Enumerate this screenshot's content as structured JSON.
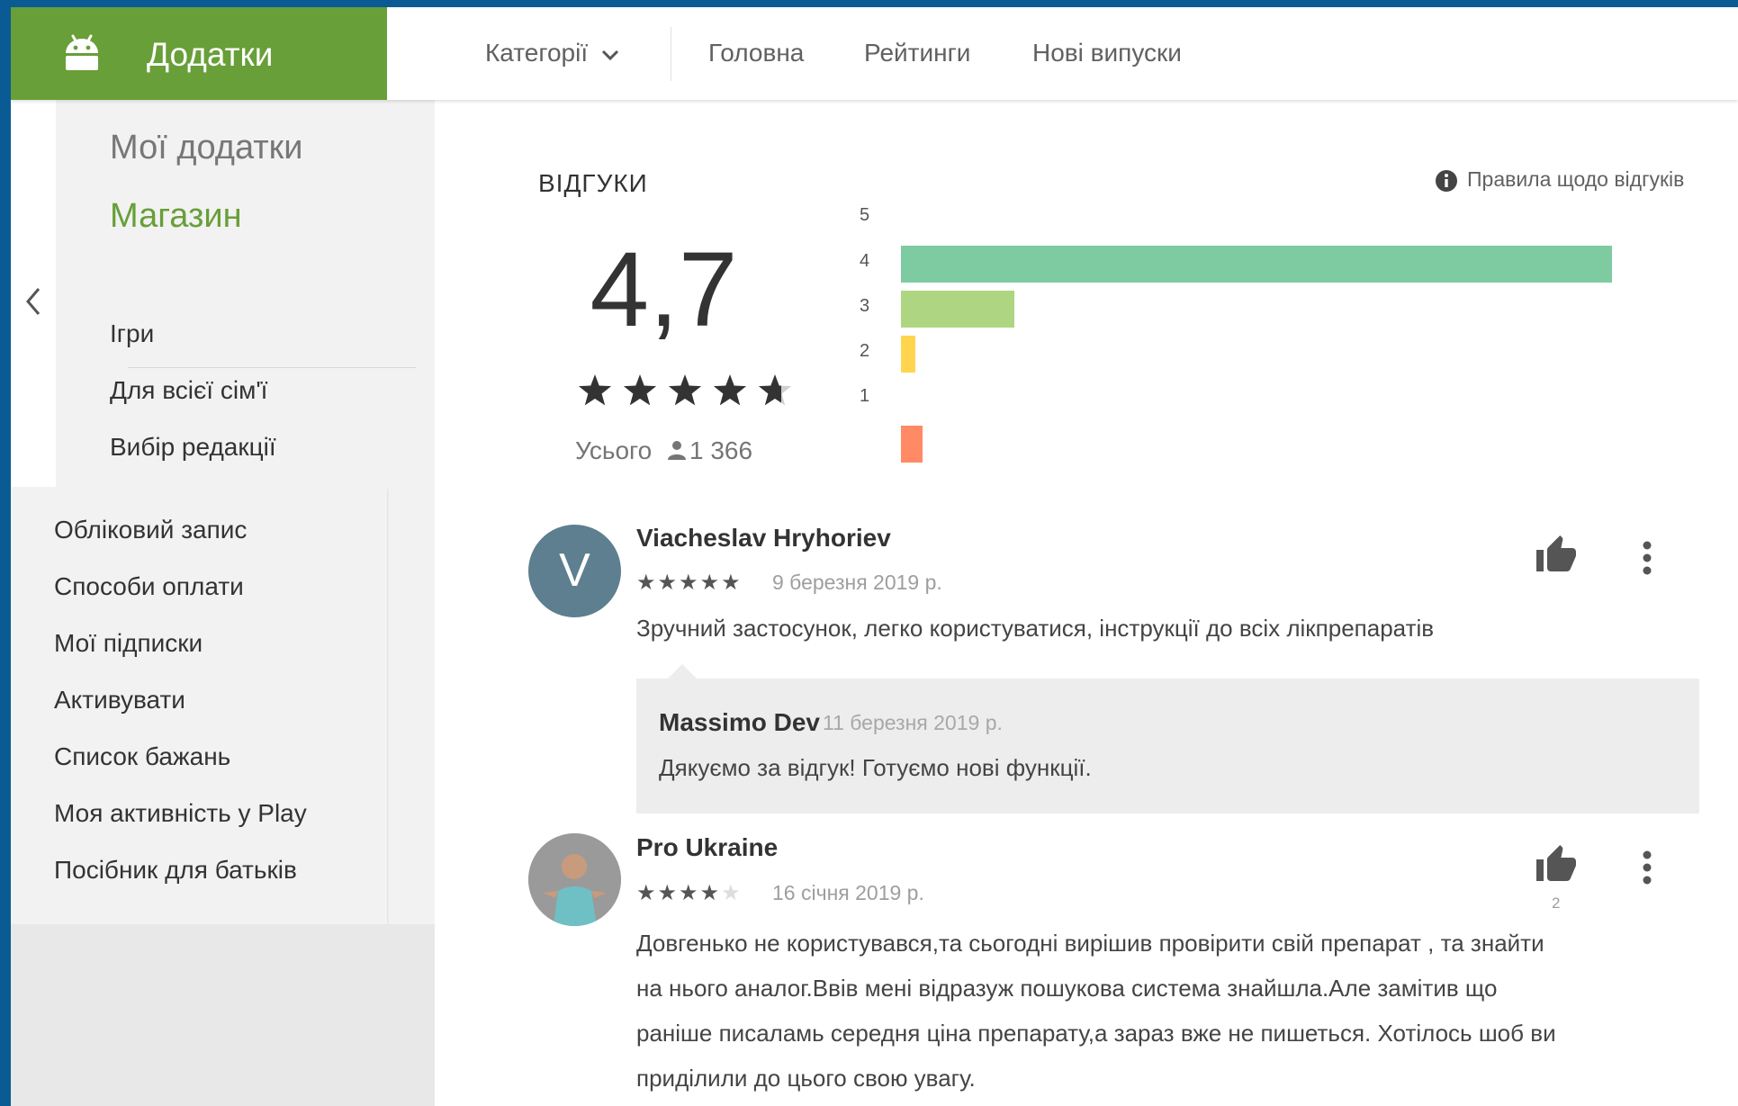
{
  "header": {
    "brand_label": "Додатки",
    "nav": {
      "categories": "Категорії",
      "home": "Головна",
      "ratings": "Рейтинги",
      "new_releases": "Нові випуски"
    }
  },
  "sidebar": {
    "my_apps": "Мої додатки",
    "store": "Магазин",
    "store_items": [
      "Ігри",
      "Для всієї сім'ї",
      "Вибір редакції"
    ],
    "account_items": [
      "Обліковий запис",
      "Способи оплати",
      "Мої підписки",
      "Активувати",
      "Список бажань",
      "Моя активність у Play",
      "Посібник для батьків"
    ]
  },
  "reviews": {
    "section_title": "ВІДГУКИ",
    "policy_link": "Правила щодо відгуків",
    "average": "4,7",
    "average_stars": 4.7,
    "total_label": "Усього",
    "total_count": "1 366",
    "histogram_labels": [
      "5",
      "4",
      "3",
      "2",
      "1"
    ],
    "histogram_fractions": [
      1.0,
      0.16,
      0.02,
      0.0,
      0.03
    ],
    "histogram_colors": [
      "#7ecba1",
      "#aed581",
      "#ffd54f",
      "#ffb74d",
      "#ff8a65"
    ],
    "items": [
      {
        "avatar_letter": "V",
        "author": "Viacheslav Hryhoriev",
        "stars": 5,
        "date": "9 березня 2019 р.",
        "text": "Зручний застосунок, легко користуватися, інструкції до всіх лікпрепаратів",
        "helpful_count": "",
        "reply": {
          "author": "Massimo Dev",
          "date": "11 березня 2019 р.",
          "text": "Дякуємо за відгук! Готуємо нові функції."
        }
      },
      {
        "author": "Pro Ukraine",
        "stars": 4,
        "date": "16 січня 2019 р.",
        "text_lines": [
          "Довгенько не користувався,та сьогодні вирішив провірити свій препарат , та знайти",
          "на нього аналог.Ввів мені відразуж пошукова система знайшла.Але замітив що",
          "раніше писаламь середня ціна препарату,а зараз вже не пишеться. Хотілось шоб ви",
          "приділили до цього свою увагу."
        ],
        "helpful_count": "2"
      }
    ]
  }
}
